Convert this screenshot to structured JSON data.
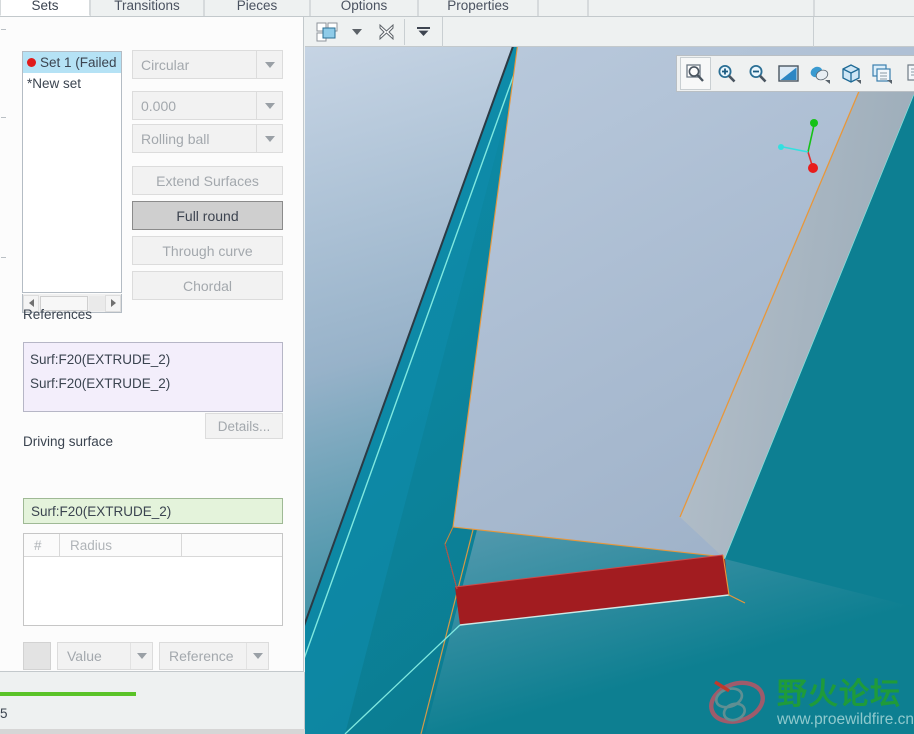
{
  "tabs": [
    {
      "label": "Sets",
      "active": true
    },
    {
      "label": "Transitions",
      "active": false
    },
    {
      "label": "Pieces",
      "active": false
    },
    {
      "label": "Options",
      "active": false
    },
    {
      "label": "Properties",
      "active": false
    }
  ],
  "sets_panel": {
    "items": [
      {
        "label": "Set 1 (Failed",
        "status": "failed",
        "selected": true
      },
      {
        "label": "*New set",
        "status": "new",
        "selected": false
      }
    ],
    "scrollbar": {
      "left_arrow": "◄",
      "right_arrow": "►"
    }
  },
  "controls": {
    "section_type": "Circular",
    "radius_value": "0.000",
    "creation_method": "Rolling ball",
    "extend_surfaces": "Extend Surfaces",
    "full_round": "Full round",
    "through_curve": "Through curve",
    "chordal": "Chordal"
  },
  "references": {
    "label": "References",
    "items": [
      "Surf:F20(EXTRUDE_2)",
      "Surf:F20(EXTRUDE_2)"
    ],
    "details_button": "Details..."
  },
  "driving_surface": {
    "label": "Driving surface",
    "value": "Surf:F20(EXTRUDE_2)"
  },
  "radius_table": {
    "columns": [
      "#",
      "Radius",
      ""
    ],
    "rows": []
  },
  "bottom_controls": {
    "value_label": "Value",
    "reference_label": "Reference"
  },
  "mini_toolbar": {
    "items": [
      {
        "name": "set-display-icon",
        "glyph": "overlap-squares"
      },
      {
        "name": "dropdown-caret",
        "glyph": "caret-down"
      },
      {
        "name": "delete-set-icon",
        "glyph": "x-cross"
      },
      {
        "name": "more-options-caret",
        "glyph": "caret-down-filled"
      }
    ]
  },
  "viewport_toolbar": {
    "items": [
      {
        "name": "zoom-fit-icon",
        "title": "Refit"
      },
      {
        "name": "zoom-in-icon",
        "title": "Zoom In"
      },
      {
        "name": "zoom-out-icon",
        "title": "Zoom Out"
      },
      {
        "name": "repaint-icon",
        "title": "Repaint"
      },
      {
        "name": "display-style-icon",
        "title": "Display Style"
      },
      {
        "name": "saved-orientations-icon",
        "title": "Saved Orientations"
      },
      {
        "name": "layer-display-icon",
        "title": "Layers"
      },
      {
        "name": "annotation-display-icon",
        "title": "Annotation Display"
      }
    ]
  },
  "status": {
    "progress_text": "5",
    "progress_color": "#5ac328"
  },
  "watermark": {
    "title": "野火论坛",
    "url": "www.proewildfire.cn"
  },
  "colors": {
    "accent_selection": "#b5e2f5",
    "failed_marker": "#e01b1b",
    "highlight_surface": "#a81f22",
    "driving_surface_bg": "#e4f3db",
    "references_bg": "#f3eefb",
    "model_teal": "#0a7e9c",
    "model_gray": "#aeb9c4",
    "edge_cyan": "#7fe8e0",
    "edge_orange": "#e8973a",
    "background_top": "#c3d2e2",
    "background_bottom": "#11808f"
  }
}
